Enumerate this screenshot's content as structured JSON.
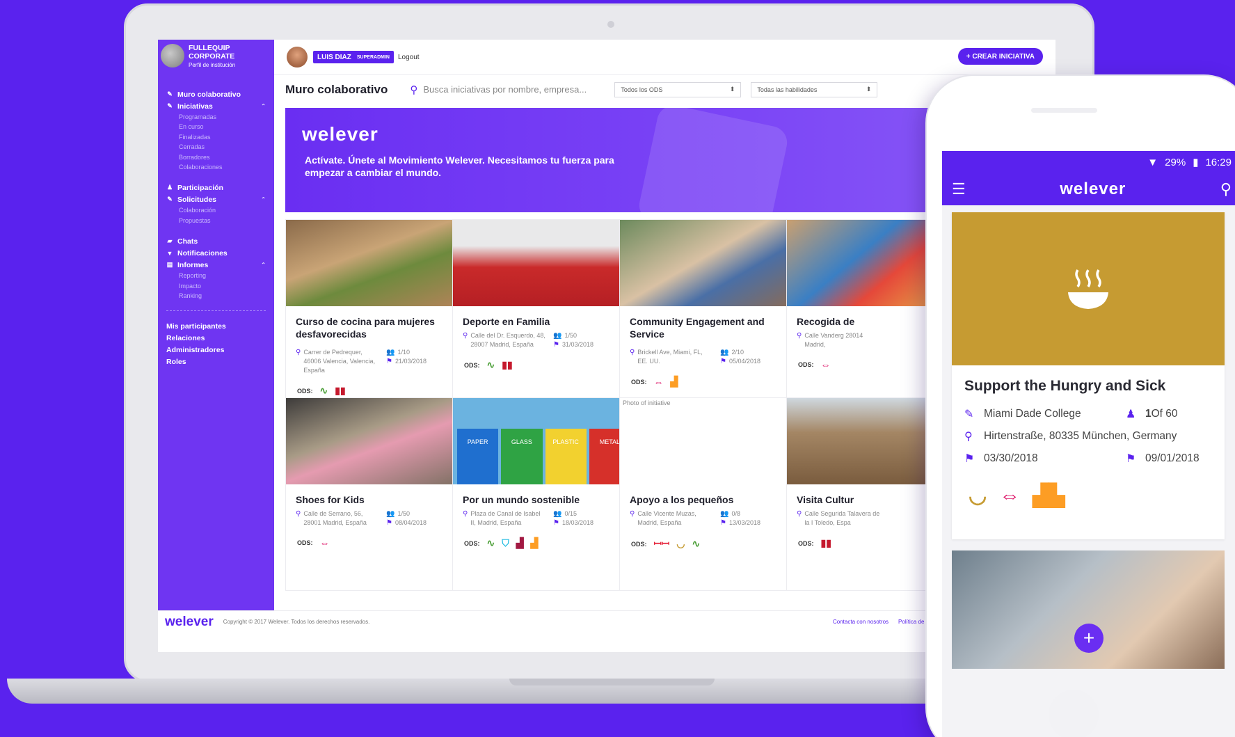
{
  "sidebar": {
    "org_name": "FULLEQUIP CORPORATE",
    "org_sub": "Perfil de institución",
    "items": [
      {
        "label": "Muro colaborativo"
      },
      {
        "label": "Iniciativas",
        "sub": [
          "Programadas",
          "En curso",
          "Finalizadas",
          "Cerradas",
          "Borradores",
          "Colaboraciones"
        ]
      },
      {
        "label": "Participación"
      },
      {
        "label": "Solicitudes",
        "sub": [
          "Colaboración",
          "Propuestas"
        ]
      },
      {
        "label": "Chats"
      },
      {
        "label": "Notificaciones"
      },
      {
        "label": "Informes",
        "sub": [
          "Reporting",
          "Impacto",
          "Ranking"
        ]
      }
    ],
    "extra": [
      "Mis participantes",
      "Relaciones",
      "Administradores",
      "Roles"
    ]
  },
  "topbar": {
    "user_name": "LUIS DIAZ",
    "user_role": "SUPERADMIN",
    "logout": "Logout",
    "create_button": "+ CREAR INICIATIVA"
  },
  "titlebar": {
    "title": "Muro colaborativo",
    "search_placeholder": "Busca iniciativas por nombre, empresa...",
    "filter_ods": "Todos los ODS",
    "filter_skills": "Todas las habilidades"
  },
  "banner": {
    "logo": "welever",
    "text": "Actívate. Únete al Movimiento Welever. Necesitamos tu fuerza para empezar a cambiar el mundo."
  },
  "cards": [
    {
      "title": "Curso de cocina para mujeres desfavorecidas",
      "location": "Carrer de Pedrequer, 46006 Valencia, Valencia, España",
      "participants": "1/10",
      "date": "21/03/2018"
    },
    {
      "title": "Deporte en Familia",
      "location": "Calle del Dr. Esquerdo, 48, 28007 Madrid, España",
      "participants": "1/50",
      "date": "31/03/2018"
    },
    {
      "title": "Community Engagement and Service",
      "location": "Brickell Ave, Miami, FL, EE. UU.",
      "participants": "2/10",
      "date": "05/04/2018"
    },
    {
      "title": "Recogida de",
      "location": "Calle Vanderg 28014 Madrid,",
      "participants": "",
      "date": ""
    },
    {
      "title": "Shoes for Kids",
      "location": "Calle de Serrano, 56, 28001 Madrid, España",
      "participants": "1/50",
      "date": "08/04/2018"
    },
    {
      "title": "Por un mundo sostenible",
      "location": "Plaza de Canal de Isabel II, Madrid, España",
      "participants": "0/15",
      "date": "18/03/2018"
    },
    {
      "title": "Apoyo a los pequeños",
      "location": "Calle Vicente Muzas, Madrid, España",
      "participants": "0/8",
      "date": "13/03/2018",
      "img_alt": "Photo of initiative"
    },
    {
      "title": "Visita Cultur",
      "location": "Calle Segurida Talavera de la I Toledo, Espa",
      "participants": "",
      "date": ""
    }
  ],
  "recycle_bins": [
    "PAPER",
    "GLASS",
    "PLASTIC",
    "METAL"
  ],
  "ods_label": "ODS:",
  "footer": {
    "logo": "welever",
    "copyright": "Copyright © 2017 Welever. Todos los derechos reservados.",
    "link_contact": "Contacta con nosotros",
    "link_policy": "Política de"
  },
  "phone": {
    "battery": "29%",
    "time": "16:29",
    "logo": "welever",
    "card": {
      "title": "Support the Hungry and Sick",
      "org": "Miami Dade College",
      "participants_count": "1",
      "participants_total": "Of 60",
      "address": "Hirtenstraße, 80335 München, Germany",
      "start_date": "03/30/2018",
      "end_date": "09/01/2018"
    }
  },
  "colors": {
    "brand": "#5a22ee",
    "sidebar": "#6f35f2",
    "ods_hunger": "#c69b32",
    "ods_health": "#4c9f38",
    "ods_education": "#c5192d",
    "ods_inequality": "#dd1367",
    "ods_cities": "#fd9d24"
  }
}
